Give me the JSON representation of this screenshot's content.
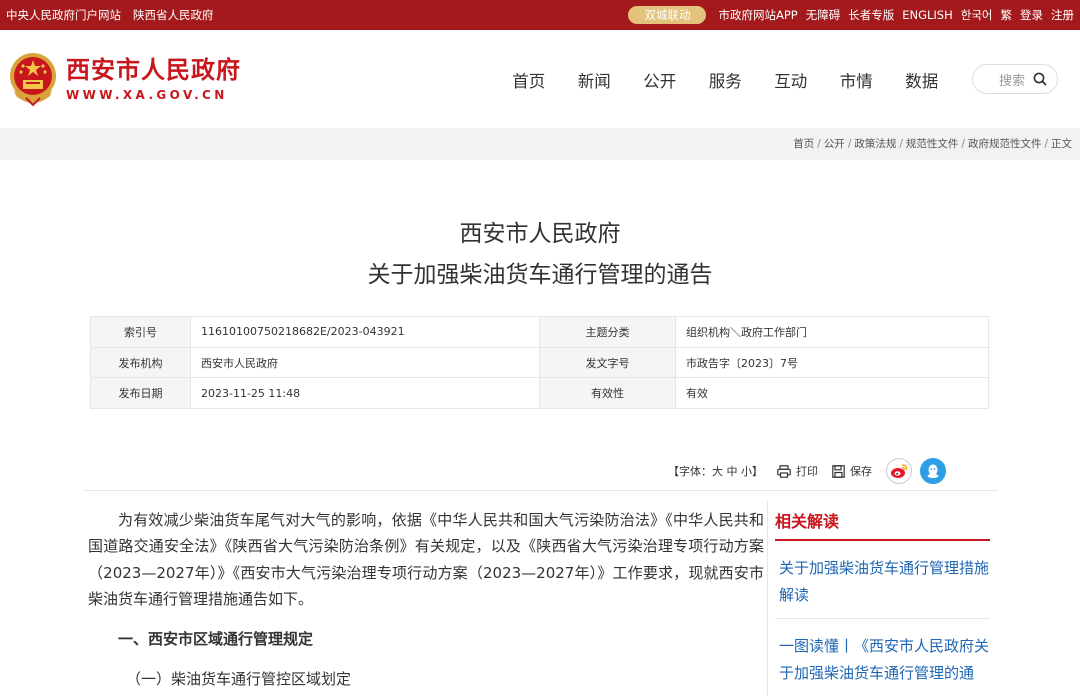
{
  "topbar": {
    "left_links": [
      "中央人民政府门户网站",
      "陕西省人民政府"
    ],
    "pill_label": "双城联动",
    "right_links": [
      "市政府网站APP",
      "无障碍",
      "长者专版",
      "ENGLISH",
      "한국어",
      "繁",
      "登录",
      "注册"
    ]
  },
  "header": {
    "site_name": "西安市人民政府",
    "site_url": "WWW.XA.GOV.CN",
    "nav": [
      "首页",
      "新闻",
      "公开",
      "服务",
      "互动",
      "市情",
      "数据"
    ],
    "search_label": "搜索"
  },
  "breadcrumb": [
    "首页",
    "公开",
    "政策法规",
    "规范性文件",
    "政府规范性文件",
    "正文"
  ],
  "document": {
    "title_line1": "西安市人民政府",
    "title_line2": "关于加强柴油货车通行管理的通告",
    "meta": [
      [
        {
          "k": "索引号",
          "v": "11610100750218682E/2023-043921"
        },
        {
          "k": "主题分类",
          "v": "组织机构＼政府工作部门"
        }
      ],
      [
        {
          "k": "发布机构",
          "v": "西安市人民政府"
        },
        {
          "k": "发文字号",
          "v": "市政告字〔2023〕7号"
        }
      ],
      [
        {
          "k": "发布日期",
          "v": "2023-11-25 11:48"
        },
        {
          "k": "有效性",
          "v": "有效"
        }
      ]
    ]
  },
  "tools": {
    "font_size_label": "【字体：大 中 小】",
    "print_label": "打印",
    "save_label": "保存",
    "share_icons": [
      "weibo-icon",
      "qq-icon"
    ]
  },
  "article": {
    "intro": "为有效减少柴油货车尾气对大气的影响，依据《中华人民共和国大气污染防治法》《中华人民共和国道路交通安全法》《陕西省大气污染防治条例》有关规定，以及《陕西省大气污染治理专项行动方案（2023—2027年）》《西安市大气污染治理专项行动方案（2023—2027年）》工作要求，现就西安市柴油货车通行管理措施通告如下。",
    "section1": "一、西安市区域通行管理规定",
    "sub1": "（一）柴油货车通行管控区域划定"
  },
  "sidebar": {
    "heading": "相关解读",
    "items": [
      "关于加强柴油货车通行管理措施解读",
      "一图读懂丨《西安市人民政府关于加强柴油货车通行管理的通"
    ]
  },
  "colors": {
    "brand_red": "#a3191c",
    "logo_red": "#c8161d",
    "pill_gold": "#e3c27c",
    "link_blue": "#1f66b3"
  }
}
